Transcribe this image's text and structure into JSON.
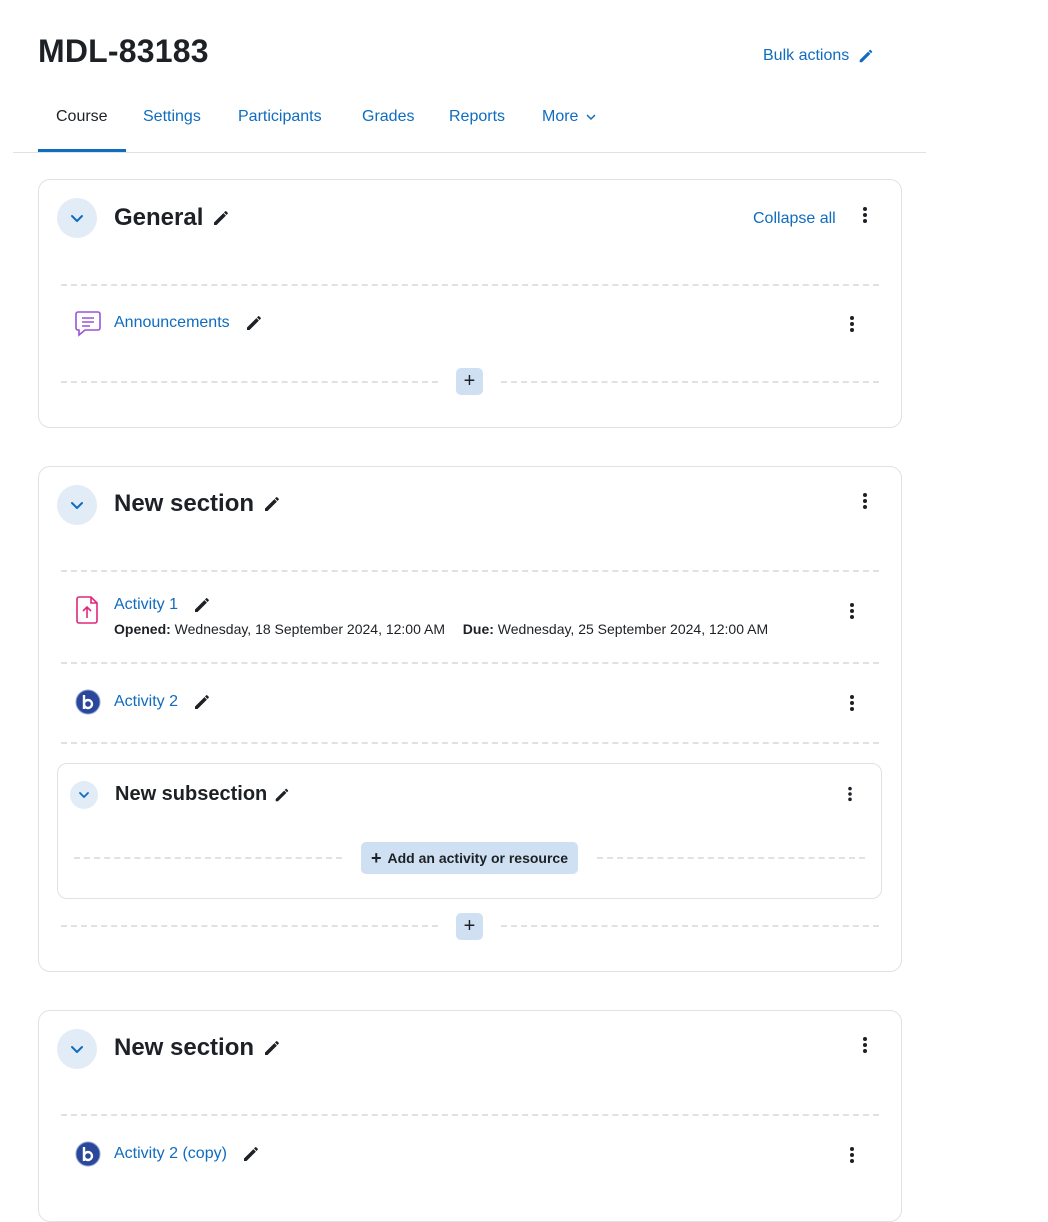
{
  "page": {
    "title": "MDL-83183",
    "bulk_actions_label": "Bulk actions"
  },
  "nav": {
    "tabs": [
      {
        "label": "Course"
      },
      {
        "label": "Settings"
      },
      {
        "label": "Participants"
      },
      {
        "label": "Grades"
      },
      {
        "label": "Reports"
      },
      {
        "label": "More"
      }
    ]
  },
  "colors": {
    "link": "#0f6cbf",
    "text": "#1d2125",
    "forum_icon": "#9954d6",
    "assign_icon": "#e0287b",
    "bbb_icon": "#2b4799"
  },
  "sections": [
    {
      "title": "General",
      "collapse_all_label": "Collapse all",
      "activities": [
        {
          "name": "Announcements",
          "icon": "forum-icon"
        }
      ]
    },
    {
      "title": "New section",
      "activities": [
        {
          "name": "Activity 1",
          "icon": "assignment-icon",
          "opened_label": "Opened:",
          "opened_value": "Wednesday, 18 September 2024, 12:00 AM",
          "due_label": "Due:",
          "due_value": "Wednesday, 25 September 2024, 12:00 AM"
        },
        {
          "name": "Activity 2",
          "icon": "bigbluebutton-icon"
        }
      ],
      "subsection": {
        "title": "New subsection",
        "add_label": "Add an activity or resource"
      }
    },
    {
      "title": "New section",
      "activities": [
        {
          "name": "Activity 2 (copy)",
          "icon": "bigbluebutton-icon"
        }
      ]
    }
  ]
}
